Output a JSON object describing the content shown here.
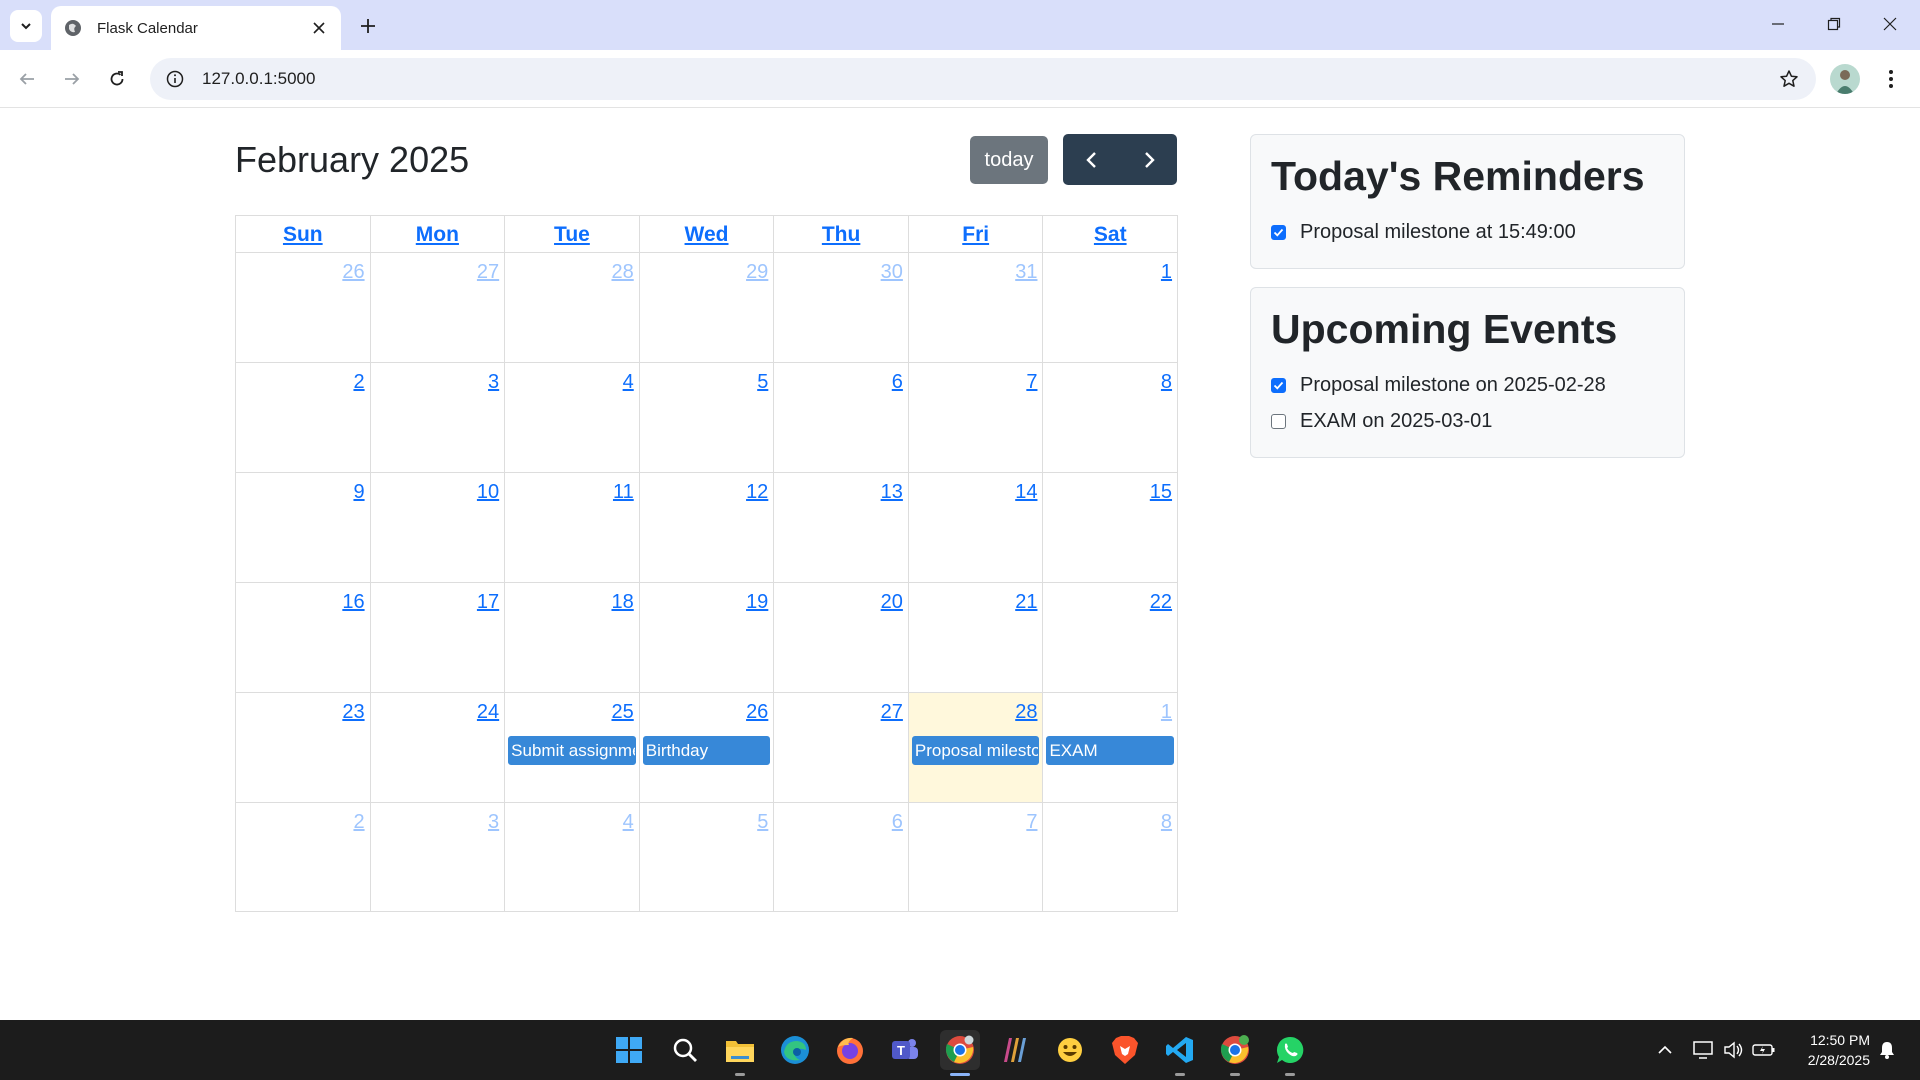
{
  "browser": {
    "tab_title": "Flask Calendar",
    "url": "127.0.0.1:5000"
  },
  "calendar": {
    "title": "February 2025",
    "today_label": "today",
    "weekdays": [
      "Sun",
      "Mon",
      "Tue",
      "Wed",
      "Thu",
      "Fri",
      "Sat"
    ],
    "weeks": [
      [
        {
          "d": "26",
          "other": true
        },
        {
          "d": "27",
          "other": true
        },
        {
          "d": "28",
          "other": true
        },
        {
          "d": "29",
          "other": true
        },
        {
          "d": "30",
          "other": true
        },
        {
          "d": "31",
          "other": true
        },
        {
          "d": "1"
        }
      ],
      [
        {
          "d": "2"
        },
        {
          "d": "3"
        },
        {
          "d": "4"
        },
        {
          "d": "5"
        },
        {
          "d": "6"
        },
        {
          "d": "7"
        },
        {
          "d": "8"
        }
      ],
      [
        {
          "d": "9"
        },
        {
          "d": "10"
        },
        {
          "d": "11"
        },
        {
          "d": "12"
        },
        {
          "d": "13"
        },
        {
          "d": "14"
        },
        {
          "d": "15"
        }
      ],
      [
        {
          "d": "16"
        },
        {
          "d": "17"
        },
        {
          "d": "18"
        },
        {
          "d": "19"
        },
        {
          "d": "20"
        },
        {
          "d": "21"
        },
        {
          "d": "22"
        }
      ],
      [
        {
          "d": "23"
        },
        {
          "d": "24"
        },
        {
          "d": "25",
          "event": "Submit assignment"
        },
        {
          "d": "26",
          "event": "Birthday"
        },
        {
          "d": "27"
        },
        {
          "d": "28",
          "today": true,
          "event": "Proposal milestone"
        },
        {
          "d": "1",
          "other": true,
          "event": "EXAM"
        }
      ],
      [
        {
          "d": "2",
          "other": true
        },
        {
          "d": "3",
          "other": true
        },
        {
          "d": "4",
          "other": true
        },
        {
          "d": "5",
          "other": true
        },
        {
          "d": "6",
          "other": true
        },
        {
          "d": "7",
          "other": true
        },
        {
          "d": "8",
          "other": true
        }
      ]
    ]
  },
  "reminders": {
    "title": "Today's Reminders",
    "items": [
      {
        "text": "Proposal milestone at 15:49:00",
        "checked": true
      }
    ]
  },
  "upcoming": {
    "title": "Upcoming Events",
    "items": [
      {
        "text": "Proposal milestone on 2025-02-28",
        "checked": true
      },
      {
        "text": "EXAM on 2025-03-01",
        "checked": false
      }
    ]
  },
  "taskbar": {
    "time": "12:50 PM",
    "date": "2/28/2025",
    "apps": [
      "start-icon",
      "search-icon",
      "file-explorer-icon",
      "edge-icon",
      "firefox-icon",
      "teams-icon",
      "chrome-icon",
      "winrar-icon",
      "emoji-app-icon",
      "brave-icon",
      "vscode-icon",
      "chrome-profile-icon",
      "whatsapp-icon"
    ]
  },
  "colors": {
    "accent": "#0d6efd",
    "event": "#3788d8",
    "today_bg": "#fff8dc",
    "nav_btn": "#2c3e50",
    "today_btn": "#6c757d"
  }
}
